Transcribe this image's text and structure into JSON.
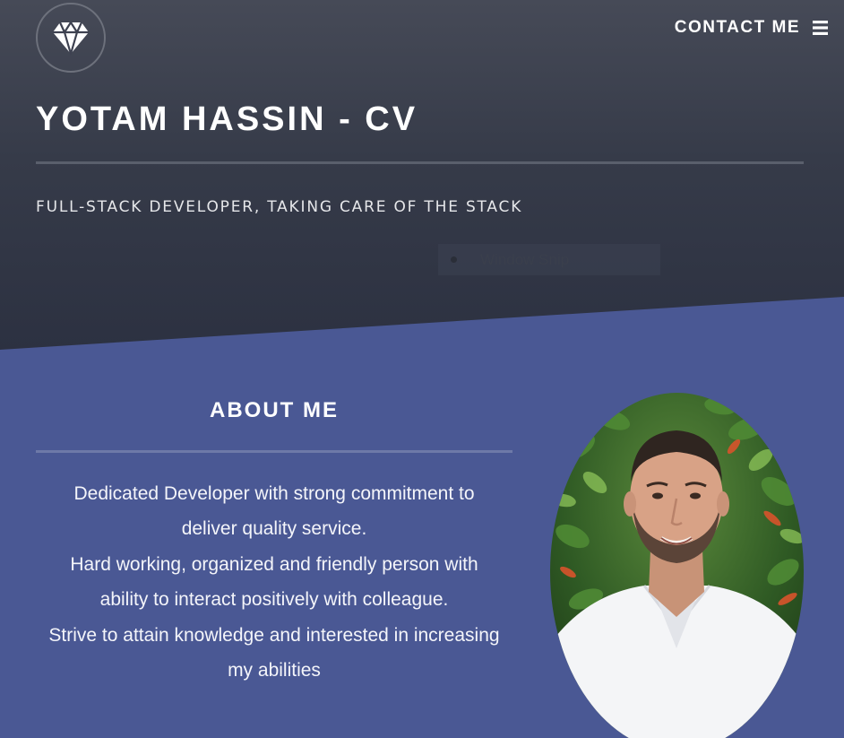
{
  "header": {
    "logo_icon": "diamond-icon",
    "contact_label": "CONTACT ME",
    "menu_icon": "hamburger-menu-icon",
    "title": "YOTAM HASSIN - CV",
    "subtitle": "FULL-STACK DEVELOPER, TAKING CARE OF THE STACK"
  },
  "overlay": {
    "label": "Window Snip"
  },
  "about": {
    "heading": "ABOUT ME",
    "lines": [
      "Dedicated Developer with strong commitment to",
      "deliver quality service.",
      "Hard working, organized and friendly person with",
      "ability to interact positively with colleague.",
      "Strive to attain knowledge and interested in increasing",
      "my abilities"
    ]
  },
  "colors": {
    "hero_top": "#464a57",
    "hero_bottom": "#2c3141",
    "about_background": "#4a5894",
    "text": "#ffffff"
  }
}
